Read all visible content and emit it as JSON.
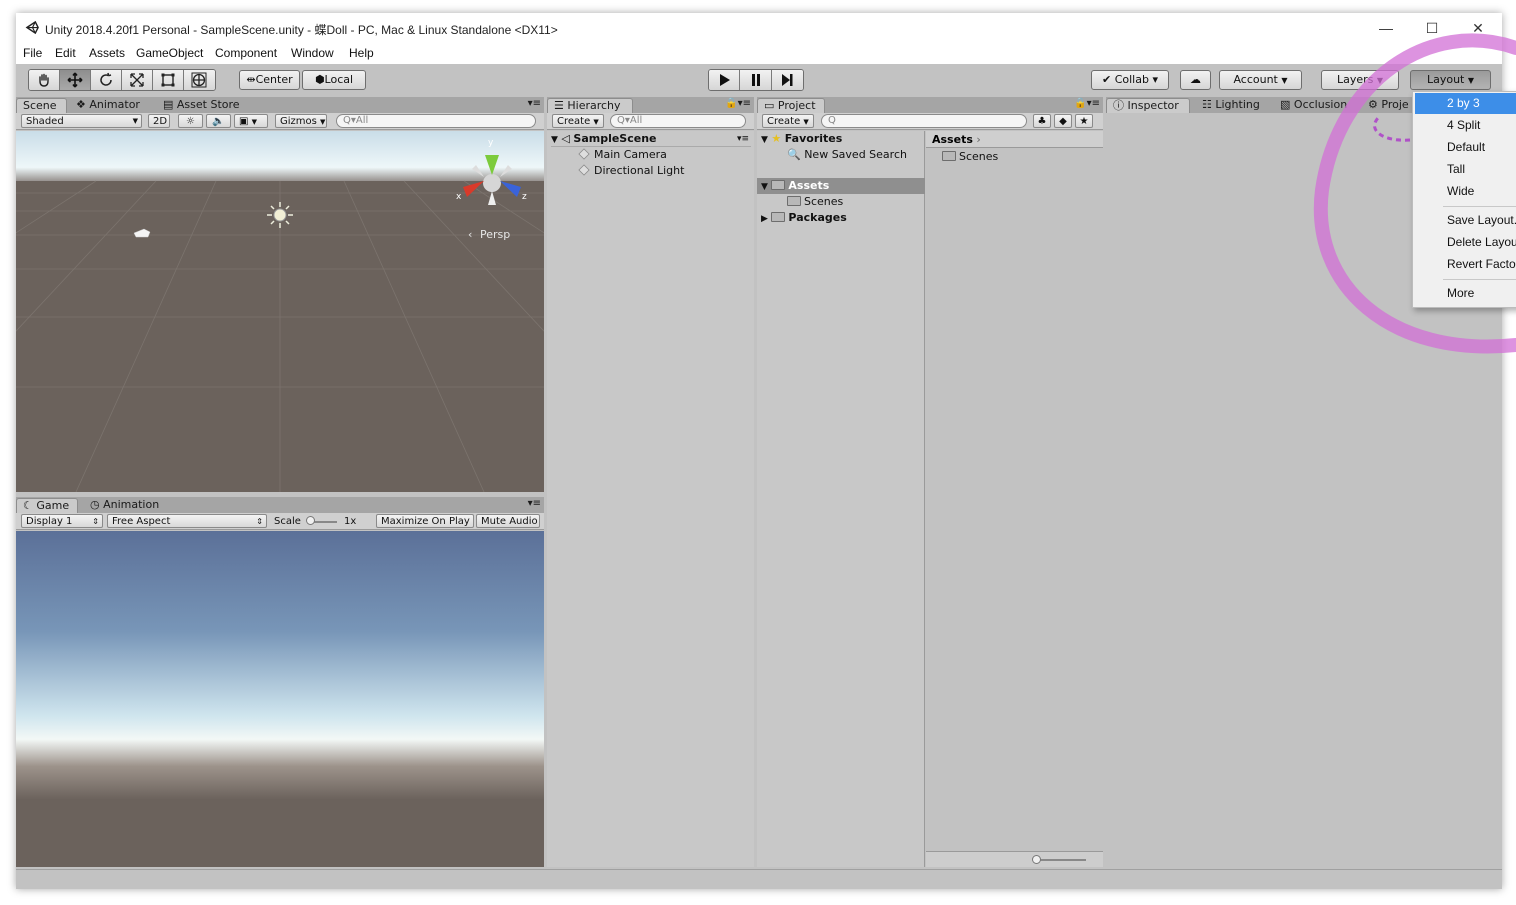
{
  "window": {
    "title": "Unity 2018.4.20f1 Personal - SampleScene.unity - 蝶Doll - PC, Mac & Linux Standalone <DX11>",
    "minimize": "—",
    "maximize": "☐",
    "close": "✕"
  },
  "menubar": [
    "File",
    "Edit",
    "Assets",
    "GameObject",
    "Component",
    "Window",
    "Help"
  ],
  "toolbar": {
    "tools": [
      "hand-icon",
      "move-icon",
      "rotate-icon",
      "scale-icon",
      "rect-icon",
      "transform-icon"
    ],
    "pivot": "Center",
    "space": "Local",
    "collab": "Collab ▾",
    "account": "Account",
    "layers": "Layers",
    "layout": "Layout"
  },
  "scene_panel": {
    "tabs": [
      "Scene",
      "Animator",
      "Asset Store"
    ],
    "shading": "Shaded",
    "mode_2d": "2D",
    "gizmos": "Gizmos",
    "search_placeholder": "All",
    "persp": "Persp",
    "axis_x": "x",
    "axis_y": "y",
    "axis_z": "z"
  },
  "game_panel": {
    "tabs": [
      "Game",
      "Animation"
    ],
    "display": "Display 1",
    "aspect": "Free Aspect",
    "scale_label": "Scale",
    "scale_value": "1x",
    "maximize": "Maximize On Play",
    "mute": "Mute Audio"
  },
  "hierarchy": {
    "tab": "Hierarchy",
    "create": "Create",
    "search_placeholder": "All",
    "scene": "SampleScene",
    "items": [
      "Main Camera",
      "Directional Light"
    ]
  },
  "project": {
    "tab": "Project",
    "create": "Create",
    "favorites": "Favorites",
    "saved_search": "New Saved Search",
    "assets": "Assets",
    "scenes": "Scenes",
    "packages": "Packages",
    "breadcrumb": "Assets",
    "content_items": [
      "Scenes"
    ]
  },
  "inspector": {
    "tabs": [
      "Inspector",
      "Lighting",
      "Occlusion",
      "Proje"
    ]
  },
  "layout_menu": {
    "items": [
      "2 by 3",
      "4 Split",
      "Default",
      "Tall",
      "Wide"
    ],
    "items2": [
      "Save Layout...",
      "Delete Layout",
      "Revert Factory"
    ],
    "items3": [
      "More"
    ]
  },
  "colors": {
    "accent_highlight": "#3d8ee8",
    "annotation": "#d26fd6",
    "editor_bg": "#c2c2c2"
  }
}
